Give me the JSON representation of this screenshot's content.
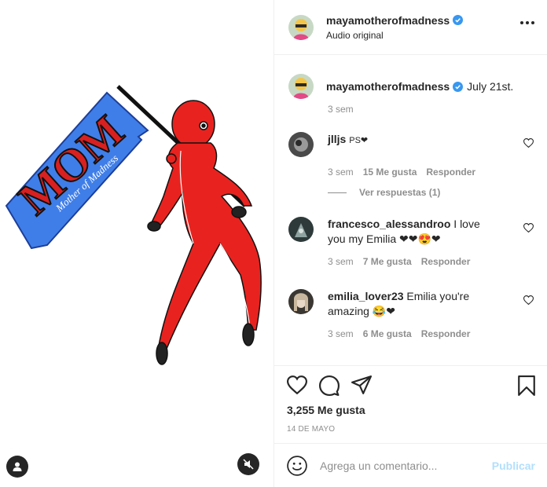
{
  "post": {
    "username": "mayamotherofmadness",
    "subtitle": "Audio original",
    "caption_text": "July 21st.",
    "caption_time": "3 sem",
    "artwork": {
      "flag_text": "MOM",
      "flag_script": "Mother of Madness"
    }
  },
  "icons": {
    "more": "more-options-icon",
    "verified": "verified-badge-icon",
    "like": "heart-icon",
    "comment": "comment-icon",
    "share": "paper-plane-icon",
    "save": "bookmark-icon",
    "emoji": "smiley-icon",
    "tag": "user-tag-icon",
    "mute": "muted-speaker-icon"
  },
  "comments": [
    {
      "username": "jlljs",
      "text": "PS❤",
      "time": "3 sem",
      "likes": "15 Me gusta",
      "reply": "Responder"
    },
    {
      "username": "francesco_alessandroo",
      "text": "I love you my Emilia ❤❤😍❤",
      "time": "3 sem",
      "likes": "7 Me gusta",
      "reply": "Responder"
    },
    {
      "username": "emilia_lover23",
      "text": "Emilia you're amazing 😂❤",
      "time": "3 sem",
      "likes": "6 Me gusta",
      "reply": "Responder"
    }
  ],
  "view_replies": "Ver respuestas (1)",
  "stats": {
    "likes": "3,255 Me gusta",
    "date": "14 DE MAYO"
  },
  "composer": {
    "placeholder": "Agrega un comentario...",
    "publish": "Publicar"
  },
  "colors": {
    "verified": "#3897f0",
    "figure_red": "#e8231f",
    "flag_blue": "#3f7ee8",
    "publish": "#b2dffc"
  }
}
